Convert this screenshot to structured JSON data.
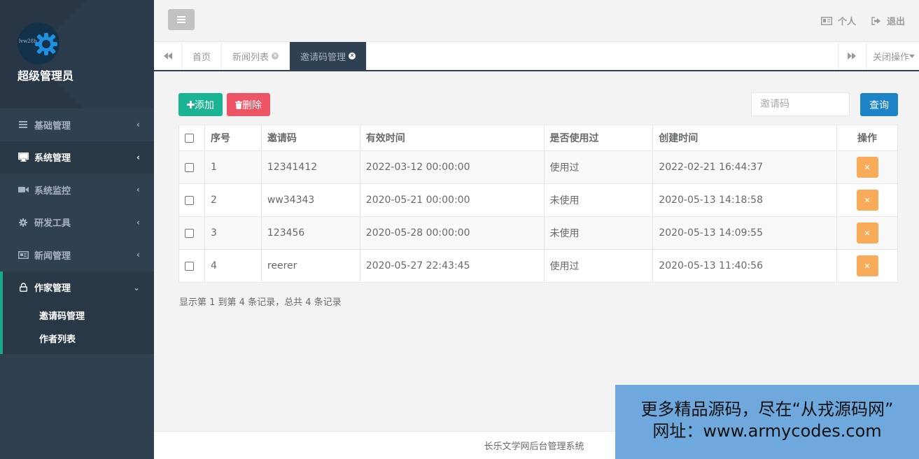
{
  "sidebar": {
    "avatar_text": "lvw28b",
    "admin_name": "超级管理员",
    "menu": [
      {
        "label": "基础管理",
        "icon": "list-icon"
      },
      {
        "label": "系统管理",
        "icon": "desktop-icon"
      },
      {
        "label": "系统监控",
        "icon": "video-camera-icon"
      },
      {
        "label": "研发工具",
        "icon": "gear-icon"
      },
      {
        "label": "新闻管理",
        "icon": "newspaper-icon"
      }
    ],
    "open_menu": {
      "label": "作家管理",
      "icon": "lock-icon"
    },
    "submenu": [
      "邀请码管理",
      "作者列表"
    ]
  },
  "header": {
    "personal": "个人",
    "logout": "退出"
  },
  "tabs": {
    "items": [
      "首页",
      "新闻列表",
      "邀请码管理"
    ],
    "close_ops": "关闭操作"
  },
  "toolbar": {
    "add": "添加",
    "delete": "删除",
    "search_placeholder": "邀请码",
    "query": "查询"
  },
  "table": {
    "headers": [
      "序号",
      "邀请码",
      "有效时间",
      "是否使用过",
      "创建时间",
      "操作"
    ],
    "rows": [
      {
        "id": "1",
        "code": "12341412",
        "valid": "2022-03-12 00:00:00",
        "used": "使用过",
        "created": "2022-02-21 16:44:37"
      },
      {
        "id": "2",
        "code": "ww34343",
        "valid": "2020-05-21 00:00:00",
        "used": "未使用",
        "created": "2020-05-13 14:18:58"
      },
      {
        "id": "3",
        "code": "123456",
        "valid": "2020-05-28 00:00:00",
        "used": "未使用",
        "created": "2020-05-13 14:09:55"
      },
      {
        "id": "4",
        "code": "reerer",
        "valid": "2020-05-27 22:43:45",
        "used": "使用过",
        "created": "2020-05-13 11:40:56"
      }
    ]
  },
  "summary": "显示第 1 到第 4 条记录，总共 4 条记录",
  "footer": "长乐文学网后台管理系统",
  "watermark": {
    "line1": "更多精品源码，尽在“从戎源码网”",
    "line2": "网址：www.armycodes.com"
  },
  "colors": {
    "sidebar": "#2f4050",
    "accent_green": "#1ab394",
    "danger": "#ed5565",
    "primary": "#1c84c6",
    "warning": "#f8ac59"
  }
}
